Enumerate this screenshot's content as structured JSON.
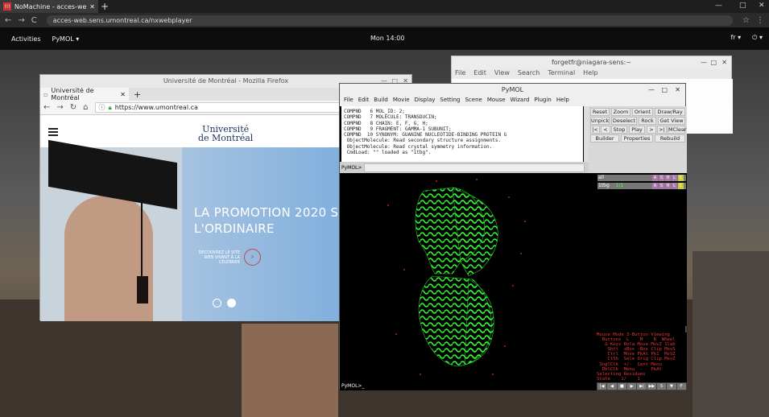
{
  "browser": {
    "tab_title": "NoMachine - acces-web.sens.umontreal.ca",
    "tab_icon_text": "!!!",
    "url": "acces-web.sens.umontreal.ca/nxwebplayer",
    "back": "←",
    "forward": "→",
    "reload": "C",
    "star": "☆",
    "menu": "⋮",
    "win_min": "—",
    "win_max": "□",
    "win_close": "✕"
  },
  "gnome": {
    "activities": "Activities",
    "app_menu": "PyMOL ▾",
    "clock": "Mon 14:00",
    "lang": "fr ▾",
    "status_icons": "⏻ ▾"
  },
  "terminal": {
    "title": "forgetfr@niagara-sens:~",
    "menu": [
      "File",
      "Edit",
      "View",
      "Search",
      "Terminal",
      "Help"
    ]
  },
  "firefox": {
    "title": "Université de Montréal - Mozilla Firefox",
    "tab": "Université de Montréal",
    "url": "https://www.umontreal.ca",
    "logo_line1": "Université",
    "logo_line2": "de Montréal",
    "promo_line1": "LA PROMOTION 2020 S",
    "promo_line2": "L'ORDINAIRE",
    "discover": "DÉCOUVREZ LE SITE WEB VIVANT À LA CÉLÉBRER",
    "arrow": "›"
  },
  "pymol": {
    "title": "PyMOL",
    "menu": [
      "File",
      "Edit",
      "Build",
      "Movie",
      "Display",
      "Setting",
      "Scene",
      "Mouse",
      "Wizard",
      "Plugin",
      "Help"
    ],
    "console": "COMPND   6 MOL_ID: 2;\nCOMPND   7 MOLECULE: TRANSDUCIN;\nCOMPND   8 CHAIN: E, F, G, H;\nCOMPND   9 FRAGMENT: GAMMA-1 SUBUNIT;\nCOMPND  10 SYNONYM: GUANINE NUCLEOTIDE-BINDING PROTEIN G\n ObjectMolecule: Read secondary structure assignments.\n ObjectMolecule: Read crystal symmetry information.\n CmdLoad: \"\" loaded as \"1tbg\".",
    "prompt": "PyMOL>",
    "bottom_prompt": "PyMOL>_",
    "buttons_row1": [
      "Reset",
      "Zoom",
      "Orient",
      "Draw/Ray ▾"
    ],
    "buttons_row2": [
      "Unpick",
      "Deselect",
      "Rock",
      "Get View"
    ],
    "buttons_row3": [
      "|<",
      "<",
      "Stop",
      "Play",
      ">",
      ">|",
      "MClear"
    ],
    "buttons_row4": [
      "Builder",
      "Properties",
      "Rebuild"
    ],
    "objects": [
      {
        "name": "all",
        "state": ""
      },
      {
        "name": "1tbg",
        "state": "1/1"
      }
    ],
    "obj_btns": [
      "A",
      "S",
      "H",
      "L",
      "C"
    ],
    "mouse_panel": "Mouse Mode 3-Button Viewing\n  Buttons  L    M    R  Wheel\n   & Keys Rota Move MovZ Slab\n    Shft  +Box -Box Clip MovS\n    Ctrl  Move PkAt Pk1  MvSZ\n    CtSh  Sele Orig Clip MovZ\n SnglClk  +/-  Cent Menu\n  DblClk  Menu  -   PkAt\nSelecting Residues\nState    1/    1",
    "movie_btns": [
      "|◀",
      "◀",
      "■",
      "▶",
      "▶|",
      "▶▶",
      "S",
      "▼",
      "F"
    ]
  }
}
